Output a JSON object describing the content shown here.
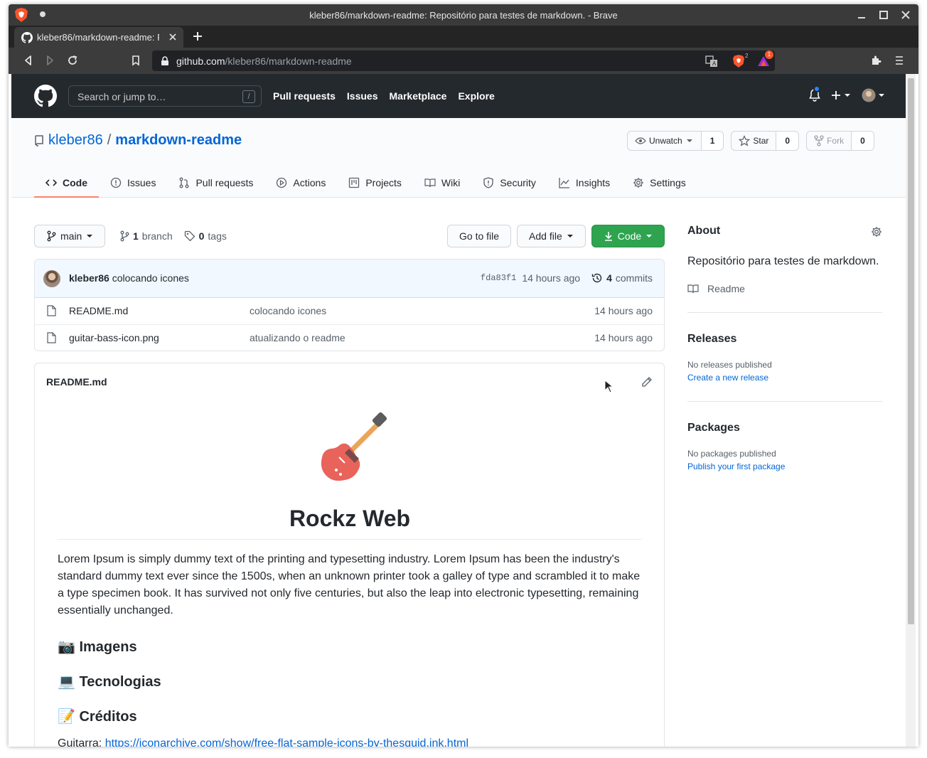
{
  "browser": {
    "window_title": "kleber86/markdown-readme: Repositório para testes de markdown. - Brave",
    "tab_title": "kleber86/markdown-readme: Repositório para testes de markdown.",
    "url_host": "github.com",
    "url_path": "/kleber86/markdown-readme",
    "shields_count": "2",
    "rewards_count": "1"
  },
  "gh_header": {
    "search_placeholder": "Search or jump to…",
    "search_shortcut": "/",
    "nav": [
      "Pull requests",
      "Issues",
      "Marketplace",
      "Explore"
    ]
  },
  "repo": {
    "owner": "kleber86",
    "separator": "/",
    "name": "markdown-readme",
    "watch_label": "Unwatch",
    "watch_count": "1",
    "star_label": "Star",
    "star_count": "0",
    "fork_label": "Fork",
    "fork_count": "0",
    "tabs": [
      "Code",
      "Issues",
      "Pull requests",
      "Actions",
      "Projects",
      "Wiki",
      "Security",
      "Insights",
      "Settings"
    ]
  },
  "code": {
    "branch": "main",
    "branch_count": "1",
    "branch_word": "branch",
    "tag_count": "0",
    "tag_word": "tags",
    "go_to_file": "Go to file",
    "add_file": "Add file",
    "code_btn": "Code"
  },
  "commit": {
    "author": "kleber86",
    "message": "colocando icones",
    "sha": "fda83f1",
    "age": "14 hours ago",
    "commit_count": "4",
    "commit_word": "commits"
  },
  "files": [
    {
      "name": "README.md",
      "message": "colocando icones",
      "age": "14 hours ago"
    },
    {
      "name": "guitar-bass-icon.png",
      "message": "atualizando o readme",
      "age": "14 hours ago"
    }
  ],
  "readme": {
    "filename": "README.md",
    "title": "Rockz Web",
    "paragraph": "Lorem Ipsum is simply dummy text of the printing and typesetting industry. Lorem Ipsum has been the industry's standard dummy text ever since the 1500s, when an unknown printer took a galley of type and scrambled it to make a type specimen book. It has survived not only five centuries, but also the leap into electronic typesetting, remaining essentially unchanged.",
    "headings": [
      "📷 Imagens",
      "💻 Tecnologias",
      "📝 Créditos"
    ],
    "credit_label": "Guitarra:",
    "credit_link": "https://iconarchive.com/show/free-flat-sample-icons-by-thesquid.ink.html"
  },
  "sidebar": {
    "about_title": "About",
    "description": "Repositório para testes de markdown.",
    "readme_label": "Readme",
    "releases_title": "Releases",
    "releases_none": "No releases published",
    "releases_link": "Create a new release",
    "packages_title": "Packages",
    "packages_none": "No packages published",
    "packages_link": "Publish your first package"
  },
  "colors": {
    "github_header": "#24292e",
    "link_blue": "#0366d6",
    "green_button": "#2ea44f",
    "selected_tab_underline": "#f9826c",
    "commit_bg": "#f1f8ff"
  }
}
